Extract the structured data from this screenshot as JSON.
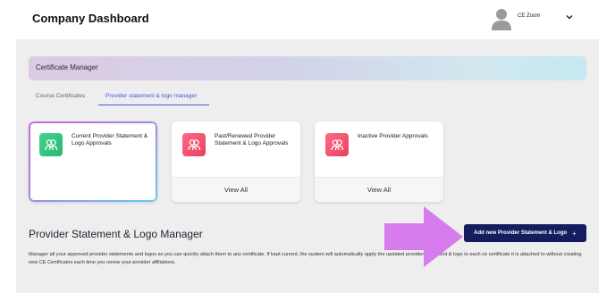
{
  "header": {
    "title": "Company Dashboard",
    "user_name": "CE Zoom"
  },
  "certificate_manager": {
    "banner_title": "Certificate Manager",
    "tabs": [
      {
        "label": "Course Certificates",
        "active": false
      },
      {
        "label": "Provider statement & logo manager",
        "active": true
      }
    ]
  },
  "cards": [
    {
      "label": "Current Provider Statement & Logo Approvals",
      "icon": "users-icon",
      "icon_color": "#2bb673",
      "selected": true,
      "footer": ""
    },
    {
      "label": "Past/Renewed Provider Statement & Logo Approvals",
      "icon": "users-icon",
      "icon_color": "#e8415e",
      "selected": false,
      "footer": "View All"
    },
    {
      "label": "Inactive Provider Approvals",
      "icon": "users-icon",
      "icon_color": "#e8415e",
      "selected": false,
      "footer": "View All"
    }
  ],
  "section": {
    "title": "Provider Statement & Logo Manager",
    "add_button_label": "Add new Provider Statement & Logo",
    "add_button_symbol": "+",
    "description": "Manager all your approved provider statements and logos so you can quickly attach them to any certificate. If kept current, the system will automatically apply the updated provider statement & logo to each ce certificate it is attached to without creating new CE Certificates each time you renew your provider affiliations."
  },
  "colors": {
    "accent": "#3d5be2",
    "button": "#151d5e",
    "arrow": "#d67cec"
  }
}
